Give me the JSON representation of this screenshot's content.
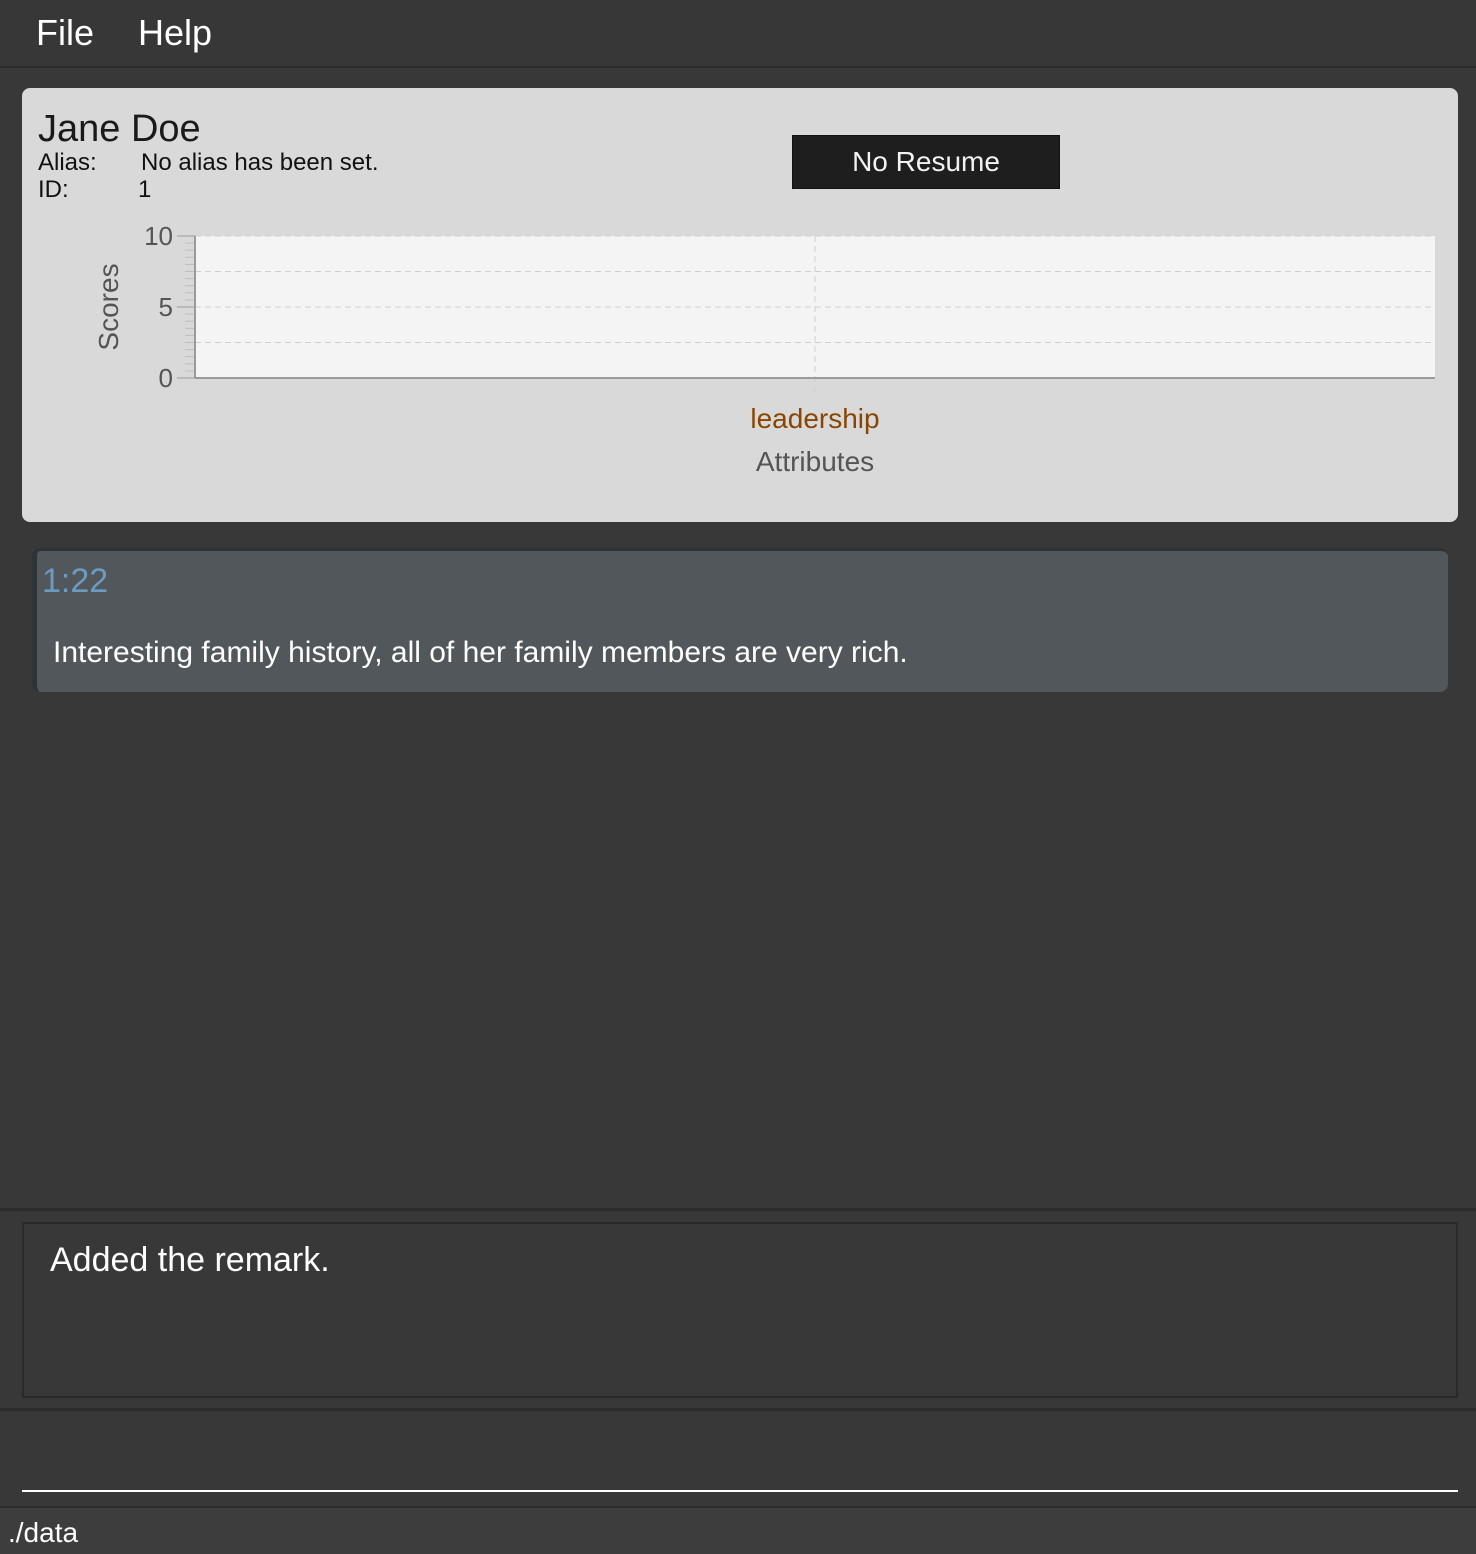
{
  "menu": {
    "file_label": "File",
    "help_label": "Help"
  },
  "person": {
    "name": "Jane Doe",
    "alias_label": "Alias:",
    "alias_value": "No alias has been set.",
    "id_label": "ID:",
    "id_value": "1",
    "resume_button_label": "No Resume"
  },
  "chart_data": {
    "type": "bar",
    "categories": [
      "leadership"
    ],
    "series": [
      {
        "values": [
          0
        ]
      }
    ],
    "xlabel": "Attributes",
    "ylabel": "Scores",
    "ylim": [
      0,
      10
    ],
    "y_ticks": [
      "0",
      "5",
      "10"
    ],
    "grid": true,
    "colors": {
      "category_label": "#8a4500",
      "plot_background": "#f4f4f4",
      "grid_line": "#cfcfcf",
      "axis_text": "#555555"
    }
  },
  "remarks": [
    {
      "time": "1:22",
      "text": "Interesting family history, all of her family members are very rich."
    }
  ],
  "result": {
    "message": "Added the remark."
  },
  "command": {
    "value": ""
  },
  "status": {
    "path": "./data"
  }
}
